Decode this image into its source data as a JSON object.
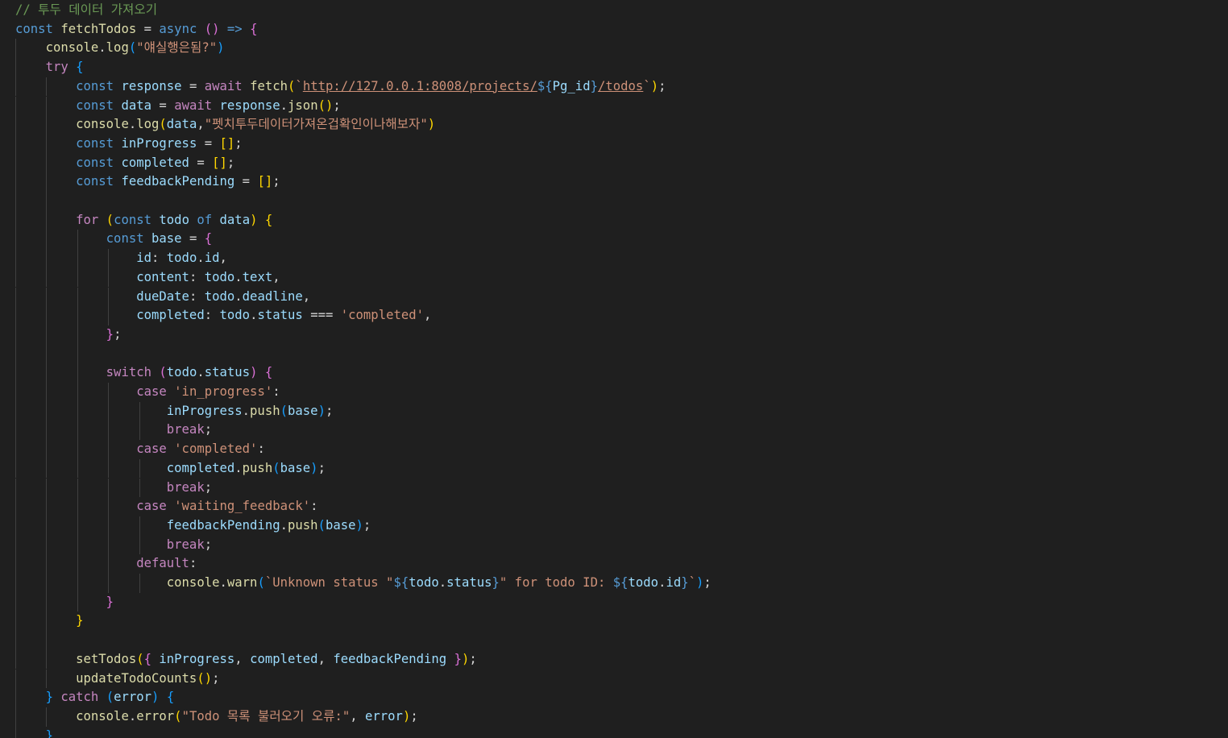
{
  "colors": {
    "background": "#1f1f1f",
    "comment": "#6a9955",
    "keyword": "#569cd6",
    "control": "#c586c0",
    "function": "#dcdcaa",
    "variable": "#9cdcfe",
    "string": "#ce9178",
    "punctuation": "#d4d4d4",
    "bracket_level1": "#ffd700",
    "bracket_level2": "#da70d6",
    "bracket_level3": "#179fff"
  },
  "code_lines": [
    [
      [
        "// 투두 데이터 가져오기",
        "t-comment"
      ]
    ],
    [
      [
        "const",
        "t-kw"
      ],
      [
        " ",
        ""
      ],
      [
        "fetchTodos",
        "t-fn"
      ],
      [
        " ",
        ""
      ],
      [
        "=",
        "t-op"
      ],
      [
        " ",
        ""
      ],
      [
        "async",
        "t-kw"
      ],
      [
        " ",
        ""
      ],
      [
        "()",
        "t-br2"
      ],
      [
        " ",
        ""
      ],
      [
        "=>",
        "t-kw"
      ],
      [
        " ",
        ""
      ],
      [
        "{",
        "t-br2"
      ]
    ],
    [
      [
        "    ",
        ""
      ],
      [
        "console",
        "t-fn"
      ],
      [
        ".",
        "t-punc"
      ],
      [
        "log",
        "t-fn"
      ],
      [
        "(",
        "t-br3"
      ],
      [
        "\"얘실행은됨?\"",
        "t-str"
      ],
      [
        ")",
        "t-br3"
      ]
    ],
    [
      [
        "    ",
        ""
      ],
      [
        "try",
        "t-ctl"
      ],
      [
        " ",
        ""
      ],
      [
        "{",
        "t-br3"
      ]
    ],
    [
      [
        "        ",
        ""
      ],
      [
        "const",
        "t-kw"
      ],
      [
        " ",
        ""
      ],
      [
        "response",
        "t-var"
      ],
      [
        " ",
        ""
      ],
      [
        "=",
        "t-op"
      ],
      [
        " ",
        ""
      ],
      [
        "await",
        "t-ctl"
      ],
      [
        " ",
        ""
      ],
      [
        "fetch",
        "t-fn"
      ],
      [
        "(",
        "t-br1"
      ],
      [
        "`",
        "t-str"
      ],
      [
        "http://127.0.0.1:8008/projects/",
        "t-url"
      ],
      [
        "${",
        "t-tplb"
      ],
      [
        "Pg_id",
        "t-var"
      ],
      [
        "}",
        "t-tplb"
      ],
      [
        "/todos",
        "t-url"
      ],
      [
        "`",
        "t-str"
      ],
      [
        ")",
        "t-br1"
      ],
      [
        ";",
        "t-punc"
      ]
    ],
    [
      [
        "        ",
        ""
      ],
      [
        "const",
        "t-kw"
      ],
      [
        " ",
        ""
      ],
      [
        "data",
        "t-var"
      ],
      [
        " ",
        ""
      ],
      [
        "=",
        "t-op"
      ],
      [
        " ",
        ""
      ],
      [
        "await",
        "t-ctl"
      ],
      [
        " ",
        ""
      ],
      [
        "response",
        "t-var"
      ],
      [
        ".",
        "t-punc"
      ],
      [
        "json",
        "t-fn"
      ],
      [
        "()",
        "t-br1"
      ],
      [
        ";",
        "t-punc"
      ]
    ],
    [
      [
        "        ",
        ""
      ],
      [
        "console",
        "t-fn"
      ],
      [
        ".",
        "t-punc"
      ],
      [
        "log",
        "t-fn"
      ],
      [
        "(",
        "t-br1"
      ],
      [
        "data",
        "t-var"
      ],
      [
        ",",
        "t-punc"
      ],
      [
        "\"펫치투두데이터가져온겁확인이나해보자\"",
        "t-str"
      ],
      [
        ")",
        "t-br1"
      ]
    ],
    [
      [
        "        ",
        ""
      ],
      [
        "const",
        "t-kw"
      ],
      [
        " ",
        ""
      ],
      [
        "inProgress",
        "t-var"
      ],
      [
        " ",
        ""
      ],
      [
        "=",
        "t-op"
      ],
      [
        " ",
        ""
      ],
      [
        "[]",
        "t-br1"
      ],
      [
        ";",
        "t-punc"
      ]
    ],
    [
      [
        "        ",
        ""
      ],
      [
        "const",
        "t-kw"
      ],
      [
        " ",
        ""
      ],
      [
        "completed",
        "t-var"
      ],
      [
        " ",
        ""
      ],
      [
        "=",
        "t-op"
      ],
      [
        " ",
        ""
      ],
      [
        "[]",
        "t-br1"
      ],
      [
        ";",
        "t-punc"
      ]
    ],
    [
      [
        "        ",
        ""
      ],
      [
        "const",
        "t-kw"
      ],
      [
        " ",
        ""
      ],
      [
        "feedbackPending",
        "t-var"
      ],
      [
        " ",
        ""
      ],
      [
        "=",
        "t-op"
      ],
      [
        " ",
        ""
      ],
      [
        "[]",
        "t-br1"
      ],
      [
        ";",
        "t-punc"
      ]
    ],
    [],
    [
      [
        "        ",
        ""
      ],
      [
        "for",
        "t-ctl"
      ],
      [
        " ",
        ""
      ],
      [
        "(",
        "t-br1"
      ],
      [
        "const",
        "t-kw"
      ],
      [
        " ",
        ""
      ],
      [
        "todo",
        "t-var"
      ],
      [
        " ",
        ""
      ],
      [
        "of",
        "t-kw"
      ],
      [
        " ",
        ""
      ],
      [
        "data",
        "t-var"
      ],
      [
        ")",
        "t-br1"
      ],
      [
        " ",
        ""
      ],
      [
        "{",
        "t-br1"
      ]
    ],
    [
      [
        "            ",
        ""
      ],
      [
        "const",
        "t-kw"
      ],
      [
        " ",
        ""
      ],
      [
        "base",
        "t-var"
      ],
      [
        " ",
        ""
      ],
      [
        "=",
        "t-op"
      ],
      [
        " ",
        ""
      ],
      [
        "{",
        "t-br2"
      ]
    ],
    [
      [
        "                ",
        ""
      ],
      [
        "id",
        "t-prop"
      ],
      [
        ":",
        "t-punc"
      ],
      [
        " ",
        ""
      ],
      [
        "todo",
        "t-var"
      ],
      [
        ".",
        "t-punc"
      ],
      [
        "id",
        "t-prop"
      ],
      [
        ",",
        "t-punc"
      ]
    ],
    [
      [
        "                ",
        ""
      ],
      [
        "content",
        "t-prop"
      ],
      [
        ":",
        "t-punc"
      ],
      [
        " ",
        ""
      ],
      [
        "todo",
        "t-var"
      ],
      [
        ".",
        "t-punc"
      ],
      [
        "text",
        "t-prop"
      ],
      [
        ",",
        "t-punc"
      ]
    ],
    [
      [
        "                ",
        ""
      ],
      [
        "dueDate",
        "t-prop"
      ],
      [
        ":",
        "t-punc"
      ],
      [
        " ",
        ""
      ],
      [
        "todo",
        "t-var"
      ],
      [
        ".",
        "t-punc"
      ],
      [
        "deadline",
        "t-prop"
      ],
      [
        ",",
        "t-punc"
      ]
    ],
    [
      [
        "                ",
        ""
      ],
      [
        "completed",
        "t-prop"
      ],
      [
        ":",
        "t-punc"
      ],
      [
        " ",
        ""
      ],
      [
        "todo",
        "t-var"
      ],
      [
        ".",
        "t-punc"
      ],
      [
        "status",
        "t-prop"
      ],
      [
        " ",
        ""
      ],
      [
        "===",
        "t-op"
      ],
      [
        " ",
        ""
      ],
      [
        "'completed'",
        "t-str"
      ],
      [
        ",",
        "t-punc"
      ]
    ],
    [
      [
        "            ",
        ""
      ],
      [
        "}",
        "t-br2"
      ],
      [
        ";",
        "t-punc"
      ]
    ],
    [],
    [
      [
        "            ",
        ""
      ],
      [
        "switch",
        "t-ctl"
      ],
      [
        " ",
        ""
      ],
      [
        "(",
        "t-br2"
      ],
      [
        "todo",
        "t-var"
      ],
      [
        ".",
        "t-punc"
      ],
      [
        "status",
        "t-prop"
      ],
      [
        ")",
        "t-br2"
      ],
      [
        " ",
        ""
      ],
      [
        "{",
        "t-br2"
      ]
    ],
    [
      [
        "                ",
        ""
      ],
      [
        "case",
        "t-ctl"
      ],
      [
        " ",
        ""
      ],
      [
        "'in_progress'",
        "t-str"
      ],
      [
        ":",
        "t-punc"
      ]
    ],
    [
      [
        "                    ",
        ""
      ],
      [
        "inProgress",
        "t-var"
      ],
      [
        ".",
        "t-punc"
      ],
      [
        "push",
        "t-fn"
      ],
      [
        "(",
        "t-br3"
      ],
      [
        "base",
        "t-var"
      ],
      [
        ")",
        "t-br3"
      ],
      [
        ";",
        "t-punc"
      ]
    ],
    [
      [
        "                    ",
        ""
      ],
      [
        "break",
        "t-ctl"
      ],
      [
        ";",
        "t-punc"
      ]
    ],
    [
      [
        "                ",
        ""
      ],
      [
        "case",
        "t-ctl"
      ],
      [
        " ",
        ""
      ],
      [
        "'completed'",
        "t-str"
      ],
      [
        ":",
        "t-punc"
      ]
    ],
    [
      [
        "                    ",
        ""
      ],
      [
        "completed",
        "t-var"
      ],
      [
        ".",
        "t-punc"
      ],
      [
        "push",
        "t-fn"
      ],
      [
        "(",
        "t-br3"
      ],
      [
        "base",
        "t-var"
      ],
      [
        ")",
        "t-br3"
      ],
      [
        ";",
        "t-punc"
      ]
    ],
    [
      [
        "                    ",
        ""
      ],
      [
        "break",
        "t-ctl"
      ],
      [
        ";",
        "t-punc"
      ]
    ],
    [
      [
        "                ",
        ""
      ],
      [
        "case",
        "t-ctl"
      ],
      [
        " ",
        ""
      ],
      [
        "'waiting_feedback'",
        "t-str"
      ],
      [
        ":",
        "t-punc"
      ]
    ],
    [
      [
        "                    ",
        ""
      ],
      [
        "feedbackPending",
        "t-var"
      ],
      [
        ".",
        "t-punc"
      ],
      [
        "push",
        "t-fn"
      ],
      [
        "(",
        "t-br3"
      ],
      [
        "base",
        "t-var"
      ],
      [
        ")",
        "t-br3"
      ],
      [
        ";",
        "t-punc"
      ]
    ],
    [
      [
        "                    ",
        ""
      ],
      [
        "break",
        "t-ctl"
      ],
      [
        ";",
        "t-punc"
      ]
    ],
    [
      [
        "                ",
        ""
      ],
      [
        "default",
        "t-ctl"
      ],
      [
        ":",
        "t-punc"
      ]
    ],
    [
      [
        "                    ",
        ""
      ],
      [
        "console",
        "t-fn"
      ],
      [
        ".",
        "t-punc"
      ],
      [
        "warn",
        "t-fn"
      ],
      [
        "(",
        "t-br3"
      ],
      [
        "`Unknown status \"",
        "t-str"
      ],
      [
        "${",
        "t-tplb"
      ],
      [
        "todo",
        "t-var"
      ],
      [
        ".",
        "t-punc"
      ],
      [
        "status",
        "t-prop"
      ],
      [
        "}",
        "t-tplb"
      ],
      [
        "\" for todo ID: ",
        "t-str"
      ],
      [
        "${",
        "t-tplb"
      ],
      [
        "todo",
        "t-var"
      ],
      [
        ".",
        "t-punc"
      ],
      [
        "id",
        "t-prop"
      ],
      [
        "}",
        "t-tplb"
      ],
      [
        "`",
        "t-str"
      ],
      [
        ")",
        "t-br3"
      ],
      [
        ";",
        "t-punc"
      ]
    ],
    [
      [
        "            ",
        ""
      ],
      [
        "}",
        "t-br2"
      ]
    ],
    [
      [
        "        ",
        ""
      ],
      [
        "}",
        "t-br1"
      ]
    ],
    [],
    [
      [
        "        ",
        ""
      ],
      [
        "setTodos",
        "t-fn"
      ],
      [
        "(",
        "t-br1"
      ],
      [
        "{",
        "t-br2"
      ],
      [
        " ",
        ""
      ],
      [
        "inProgress",
        "t-var"
      ],
      [
        ",",
        "t-punc"
      ],
      [
        " ",
        ""
      ],
      [
        "completed",
        "t-var"
      ],
      [
        ",",
        "t-punc"
      ],
      [
        " ",
        ""
      ],
      [
        "feedbackPending",
        "t-var"
      ],
      [
        " ",
        ""
      ],
      [
        "}",
        "t-br2"
      ],
      [
        ")",
        "t-br1"
      ],
      [
        ";",
        "t-punc"
      ]
    ],
    [
      [
        "        ",
        ""
      ],
      [
        "updateTodoCounts",
        "t-fn"
      ],
      [
        "()",
        "t-br1"
      ],
      [
        ";",
        "t-punc"
      ]
    ],
    [
      [
        "    ",
        ""
      ],
      [
        "}",
        "t-br3"
      ],
      [
        " ",
        ""
      ],
      [
        "catch",
        "t-ctl"
      ],
      [
        " ",
        ""
      ],
      [
        "(",
        "t-br3"
      ],
      [
        "error",
        "t-var"
      ],
      [
        ")",
        "t-br3"
      ],
      [
        " ",
        ""
      ],
      [
        "{",
        "t-br3"
      ]
    ],
    [
      [
        "        ",
        ""
      ],
      [
        "console",
        "t-fn"
      ],
      [
        ".",
        "t-punc"
      ],
      [
        "error",
        "t-fn"
      ],
      [
        "(",
        "t-br1"
      ],
      [
        "\"Todo 목록 불러오기 오류:\"",
        "t-str"
      ],
      [
        ",",
        "t-punc"
      ],
      [
        " ",
        ""
      ],
      [
        "error",
        "t-var"
      ],
      [
        ")",
        "t-br1"
      ],
      [
        ";",
        "t-punc"
      ]
    ],
    [
      [
        "    ",
        ""
      ],
      [
        "}",
        "t-br3"
      ]
    ]
  ]
}
